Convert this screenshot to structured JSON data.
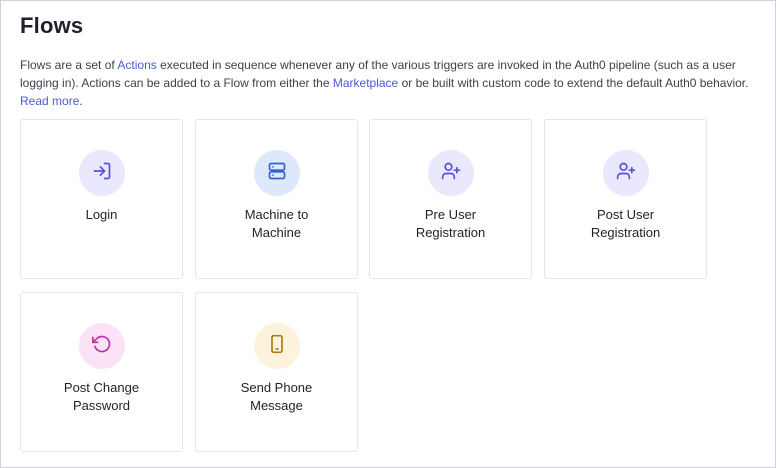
{
  "page": {
    "title": "Flows",
    "description": {
      "part1": "Flows are a set of ",
      "actions_link": "Actions",
      "part2": " executed in sequence whenever any of the various triggers are invoked in the Auth0 pipeline (such as a user logging in). Actions can be added to a Flow from either the ",
      "marketplace_link": "Marketplace",
      "part3": " or be built with custom code to extend the default Auth0 behavior. ",
      "read_more_link": "Read more",
      "part4": "."
    }
  },
  "flows": [
    {
      "line1": "Login",
      "line2": "",
      "icon": "login-arrow-icon",
      "bg": "#e9e8fc",
      "fg": "#5b4fd6"
    },
    {
      "line1": "Machine to",
      "line2": "Machine",
      "icon": "server-icon",
      "bg": "#dde9fb",
      "fg": "#2f62c9"
    },
    {
      "line1": "Pre User",
      "line2": "Registration",
      "icon": "user-plus-icon",
      "bg": "#e9e8fc",
      "fg": "#5b4fd6"
    },
    {
      "line1": "Post User",
      "line2": "Registration",
      "icon": "user-plus-icon",
      "bg": "#e9e8fc",
      "fg": "#5b4fd6"
    },
    {
      "line1": "Post Change",
      "line2": "Password",
      "icon": "rotate-ccw-icon",
      "bg": "#fbe2f4",
      "fg": "#c02ea1"
    },
    {
      "line1": "Send Phone",
      "line2": "Message",
      "icon": "smartphone-icon",
      "bg": "#fdf3dc",
      "fg": "#b07a12"
    }
  ]
}
